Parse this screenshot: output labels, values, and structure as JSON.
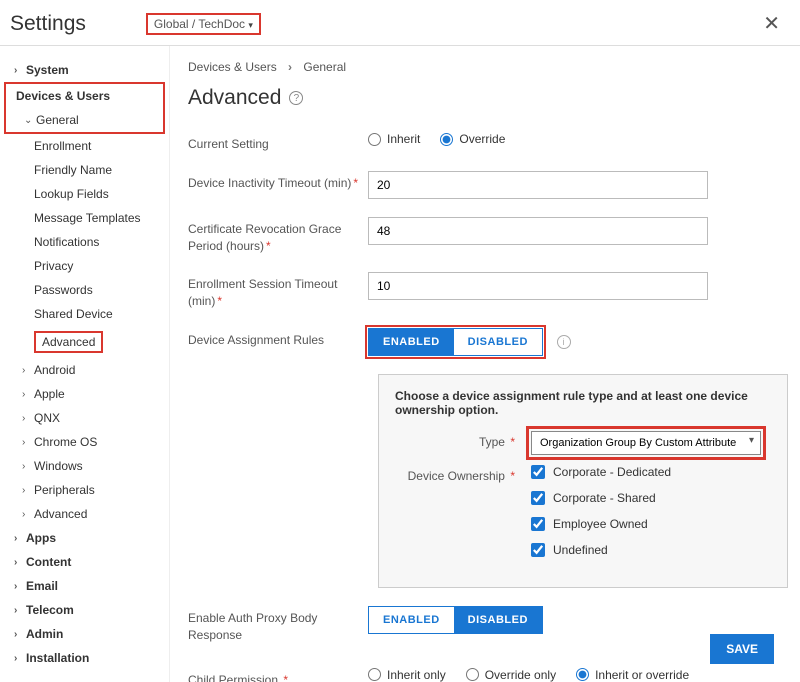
{
  "header": {
    "title": "Settings",
    "org_group": "Global / TechDoc"
  },
  "breadcrumb": {
    "parent": "Devices & Users",
    "current": "General"
  },
  "page_title": "Advanced",
  "sidebar": {
    "system": {
      "label": "System"
    },
    "devices_users": {
      "label": "Devices & Users"
    },
    "general": {
      "label": "General"
    },
    "general_children": {
      "enrollment": "Enrollment",
      "friendly_name": "Friendly Name",
      "lookup_fields": "Lookup Fields",
      "message_templates": "Message Templates",
      "notifications": "Notifications",
      "privacy": "Privacy",
      "passwords": "Passwords",
      "shared_device": "Shared Device",
      "advanced": "Advanced"
    },
    "android": "Android",
    "apple": "Apple",
    "qnx": "QNX",
    "chromeos": "Chrome OS",
    "windows": "Windows",
    "peripherals": "Peripherals",
    "advanced_du": "Advanced",
    "apps": "Apps",
    "content": "Content",
    "email": "Email",
    "telecom": "Telecom",
    "admin": "Admin",
    "installation": "Installation"
  },
  "form": {
    "current_setting": {
      "label": "Current Setting",
      "inherit": "Inherit",
      "override": "Override",
      "value": "override"
    },
    "device_inactivity": {
      "label": "Device Inactivity Timeout (min)",
      "value": "20"
    },
    "cert_revocation": {
      "label": "Certificate Revocation Grace Period (hours)",
      "value": "48"
    },
    "enrollment_timeout": {
      "label": "Enrollment Session Timeout (min)",
      "value": "10"
    },
    "device_rules": {
      "label": "Device Assignment Rules",
      "enabled": "ENABLED",
      "disabled": "DISABLED",
      "value": "enabled"
    },
    "panel": {
      "title": "Choose a device assignment rule type and at least one device ownership option.",
      "type_label": "Type",
      "type_value": "Organization Group By Custom Attribute",
      "ownership_label": "Device Ownership",
      "ownership_options": {
        "corporate_dedicated": "Corporate - Dedicated",
        "corporate_shared": "Corporate - Shared",
        "employee_owned": "Employee Owned",
        "undefined": "Undefined"
      }
    },
    "auth_proxy": {
      "label": "Enable Auth Proxy Body Response",
      "enabled": "ENABLED",
      "disabled": "DISABLED",
      "value": "disabled"
    },
    "child_permission": {
      "label": "Child Permission",
      "inherit_only": "Inherit only",
      "override_only": "Override only",
      "inherit_or_override": "Inherit or override",
      "value": "inherit_or_override"
    },
    "save": "SAVE"
  }
}
